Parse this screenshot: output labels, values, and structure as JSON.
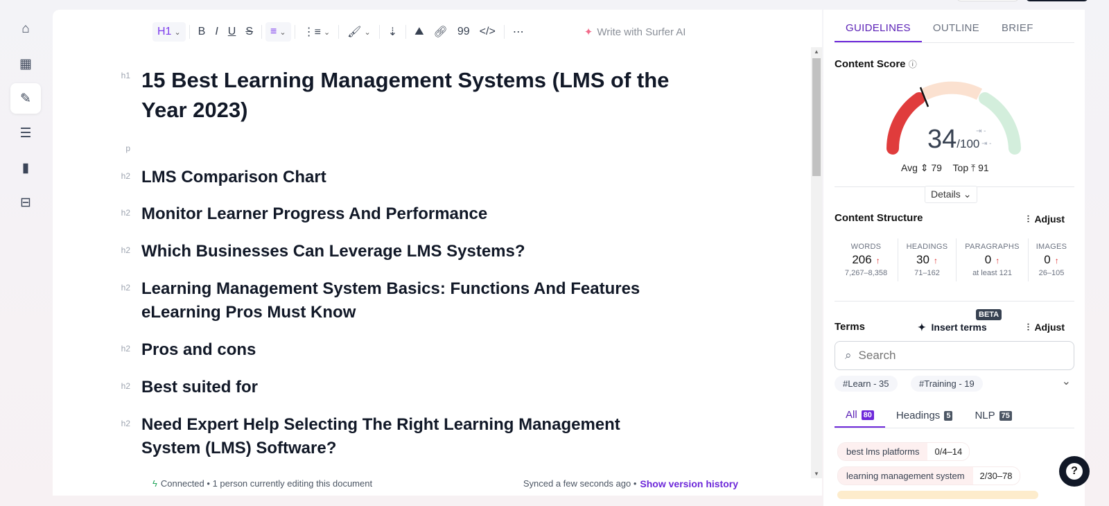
{
  "sidebar": {
    "items": [
      {
        "icon": "home-icon"
      },
      {
        "icon": "dashboard-icon"
      },
      {
        "icon": "content-editor-icon",
        "active": true
      },
      {
        "icon": "list-icon"
      },
      {
        "icon": "chart-icon"
      },
      {
        "icon": "document-icon"
      }
    ]
  },
  "toolbar": {
    "heading": "H1",
    "bold": "B",
    "italic": "I",
    "underline": "U",
    "strike": "S",
    "ai_label": "Write with Surfer AI"
  },
  "document": {
    "blocks": [
      {
        "tag": "h1",
        "text": "15 Best Learning Management Systems (LMS of the Year 2023)"
      },
      {
        "tag": "p",
        "text": ""
      },
      {
        "tag": "h2",
        "text": "LMS Comparison Chart"
      },
      {
        "tag": "h2",
        "text": "Monitor Learner Progress And Performance"
      },
      {
        "tag": "h2",
        "text": "Which Businesses Can Leverage LMS Systems?"
      },
      {
        "tag": "h2",
        "text": "Learning Management System Basics: Functions And Features eLearning Pros Must Know"
      },
      {
        "tag": "h2",
        "text": "Pros and cons"
      },
      {
        "tag": "h2",
        "text": "Best suited for"
      },
      {
        "tag": "h2",
        "text": "Need Expert Help Selecting The Right Learning Management System (LMS) Software?"
      }
    ]
  },
  "status": {
    "connected": "Connected",
    "editing": "• 1 person currently editing this document",
    "synced": "Synced a few seconds ago •",
    "version_link": "Show version history"
  },
  "panel": {
    "tabs": [
      "GUIDELINES",
      "OUTLINE",
      "BRIEF"
    ],
    "content_score": {
      "title": "Content Score",
      "score": 34,
      "score_text": "34",
      "max_text": "/100",
      "avg_label": "Avg",
      "avg": "79",
      "top_label": "Top",
      "top": "91",
      "details": "Details"
    },
    "structure": {
      "title": "Content Structure",
      "adjust": "Adjust",
      "cols": [
        {
          "label": "WORDS",
          "value": "206",
          "range": "7,267–8,358"
        },
        {
          "label": "HEADINGS",
          "value": "30",
          "range": "71–162"
        },
        {
          "label": "PARAGRAPHS",
          "value": "0",
          "range": "at least 121"
        },
        {
          "label": "IMAGES",
          "value": "0",
          "range": "26–105"
        }
      ]
    },
    "terms": {
      "title": "Terms",
      "insert": "Insert terms",
      "beta": "BETA",
      "adjust": "Adjust",
      "search_placeholder": "Search",
      "chips": [
        "#Learn - 35",
        "#Training - 19"
      ],
      "filters": [
        {
          "label": "All",
          "count": "80"
        },
        {
          "label": "Headings",
          "count": "5"
        },
        {
          "label": "NLP",
          "count": "75"
        }
      ],
      "items": [
        {
          "term": "best lms platforms",
          "count": "0/4–14"
        },
        {
          "term": "learning management system",
          "count": "2/30–78"
        }
      ]
    }
  },
  "help": "?",
  "colors": {
    "accent": "#6d28d9",
    "red": "#e03c3c",
    "peach": "#fbe1d0",
    "green": "#d3eedc"
  }
}
